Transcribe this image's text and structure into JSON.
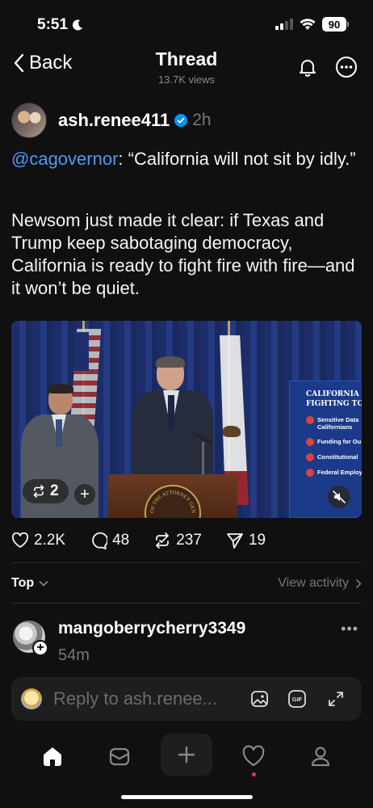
{
  "status_bar": {
    "time": "5:51",
    "battery": "90"
  },
  "nav": {
    "back_label": "Back",
    "title": "Thread",
    "views": "13.7K views"
  },
  "post": {
    "username": "ash.renee411",
    "time": "2h",
    "mention": "@cagovernor",
    "quote": ": “California will not sit by idly.”",
    "body": "Newsom just made it clear: if Texas and Trump keep sabotaging democracy, California is ready to fight fire with fire—and it won’t be quiet.",
    "media": {
      "banner_title_1": "CALIFORNIA D",
      "banner_title_2": "FIGHTING TO PR",
      "banner_items": [
        "Sensitive Data",
        "Californians",
        "Funding for Ou",
        "Constitutional",
        "Federal Employ"
      ],
      "seal_text": "OF THE ATTORNEY GENE",
      "repost_count": "2"
    },
    "stats": {
      "likes": "2.2K",
      "comments": "48",
      "reposts": "237",
      "shares": "19"
    }
  },
  "sort": {
    "label": "Top",
    "view_activity": "View activity"
  },
  "reply": {
    "username": "mangoberrycherry3349",
    "time": "54m"
  },
  "composer": {
    "placeholder": "Reply to ash.renee..."
  },
  "icons": {
    "back": "chevron-left-icon",
    "notifications": "bell-icon",
    "more": "more-circle-icon",
    "verified": "verified-badge-icon",
    "like": "heart-icon",
    "comment": "comment-icon",
    "repost": "repost-icon",
    "share": "send-icon",
    "tabs": [
      "home-icon",
      "inbox-icon",
      "plus-icon",
      "heart-icon",
      "profile-icon"
    ]
  },
  "colors": {
    "background": "#101010",
    "mention": "#4a9cf6",
    "verified": "#0095f6",
    "notification_dot": "#ff3040"
  }
}
